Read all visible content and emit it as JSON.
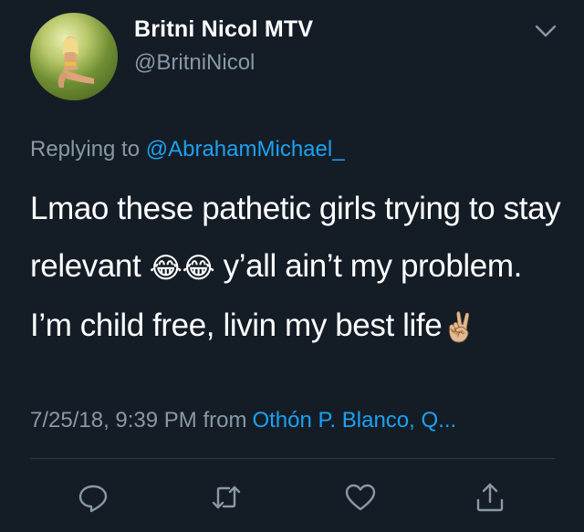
{
  "user": {
    "display_name": "Britni Nicol MTV",
    "handle": "@BritniNicol"
  },
  "reply": {
    "prefix": "Replying to ",
    "mention": "@AbrahamMichael_"
  },
  "tweet": {
    "text_part1": "Lmao these pathetic girls trying to stay relevant ",
    "emoji1": "😂😂",
    "text_part2": " y’all ain’t my problem. I’m child free, livin my best life",
    "emoji2": "✌🏼"
  },
  "meta": {
    "timestamp": "7/25/18, 9:39 PM from",
    "location": "Othón P. Blanco, Q..."
  },
  "icons": {
    "chevron": "chevron-down-icon",
    "reply": "reply-icon",
    "retweet": "retweet-icon",
    "like": "heart-icon",
    "share": "share-icon"
  },
  "colors": {
    "background": "#141d26",
    "secondary_text": "#8899a6",
    "accent": "#1da1f2"
  }
}
